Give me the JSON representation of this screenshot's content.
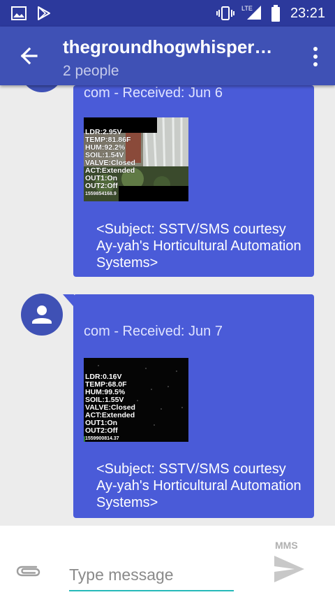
{
  "status": {
    "time": "23:21",
    "network": "LTE"
  },
  "header": {
    "title": "thegroundhogwhisper…",
    "subtitle": "2 people"
  },
  "messages": [
    {
      "meta": "com - Received: Jun 6",
      "image_caption": [
        "LDR:2.95V",
        "TEMP:81.86F",
        "HUM:92.2%",
        "SOIL:1.54V",
        "VALVE:Closed",
        "ACT:Extended",
        "OUT1:On",
        "OUT2:Off",
        "1559854168.9"
      ],
      "text": "<Subject: SSTV/SMS courtesy Ay-yah's Horticultural Automation Systems>"
    },
    {
      "meta": "com - Received: Jun 7",
      "image_caption": [
        "LDR:0.16V",
        "TEMP:68.0F",
        "HUM:99.5%",
        "SOIL:1.55V",
        "VALVE:Closed",
        "ACT:Extended",
        "OUT1:On",
        "OUT2:Off",
        "1559900814.37"
      ],
      "text": "<Subject: SSTV/SMS courtesy Ay-yah's Horticultural Automation Systems>"
    }
  ],
  "compose": {
    "placeholder": "Type message",
    "send_mode": "MMS"
  },
  "icons": {
    "status_left": [
      "gallery-icon",
      "play-store-icon"
    ],
    "status_right": [
      "vibrate-icon",
      "signal-icon",
      "battery-icon"
    ],
    "appbar": [
      "back-arrow-icon",
      "overflow-menu-icon"
    ],
    "compose": [
      "attach-icon",
      "send-icon"
    ]
  },
  "colors": {
    "status_bar": "#2c399c",
    "app_bar": "#3f51b5",
    "bubble": "#4a5bd8",
    "accent": "#26b9b9"
  }
}
